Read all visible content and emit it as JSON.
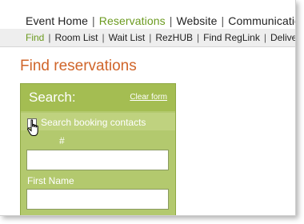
{
  "top_nav": [
    {
      "label": "Event Home",
      "active": false
    },
    {
      "label": "Reservations",
      "active": true
    },
    {
      "label": "Website",
      "active": false
    },
    {
      "label": "Communications",
      "active": false
    }
  ],
  "top_nav_separator": "|",
  "sub_nav": [
    {
      "label": "Find",
      "active": true
    },
    {
      "label": "Room List",
      "active": false
    },
    {
      "label": "Wait List",
      "active": false
    },
    {
      "label": "RezHUB",
      "active": false
    },
    {
      "label": "Find RegLink",
      "active": false
    },
    {
      "label": "Delive",
      "active": false
    }
  ],
  "page_title": "Find reservations",
  "search_panel": {
    "title": "Search:",
    "clear_link": "Clear form",
    "contacts_checkbox_label": "Search booking contacts",
    "contacts_checked": false,
    "field1_label": "#",
    "field1_value": "",
    "field2_label": "First Name",
    "field2_value": ""
  },
  "colors": {
    "accent_green": "#6b9a1f",
    "title_orange": "#d0652a",
    "panel_green": "#a8c15b"
  },
  "cursor": "hand-pointer-icon"
}
